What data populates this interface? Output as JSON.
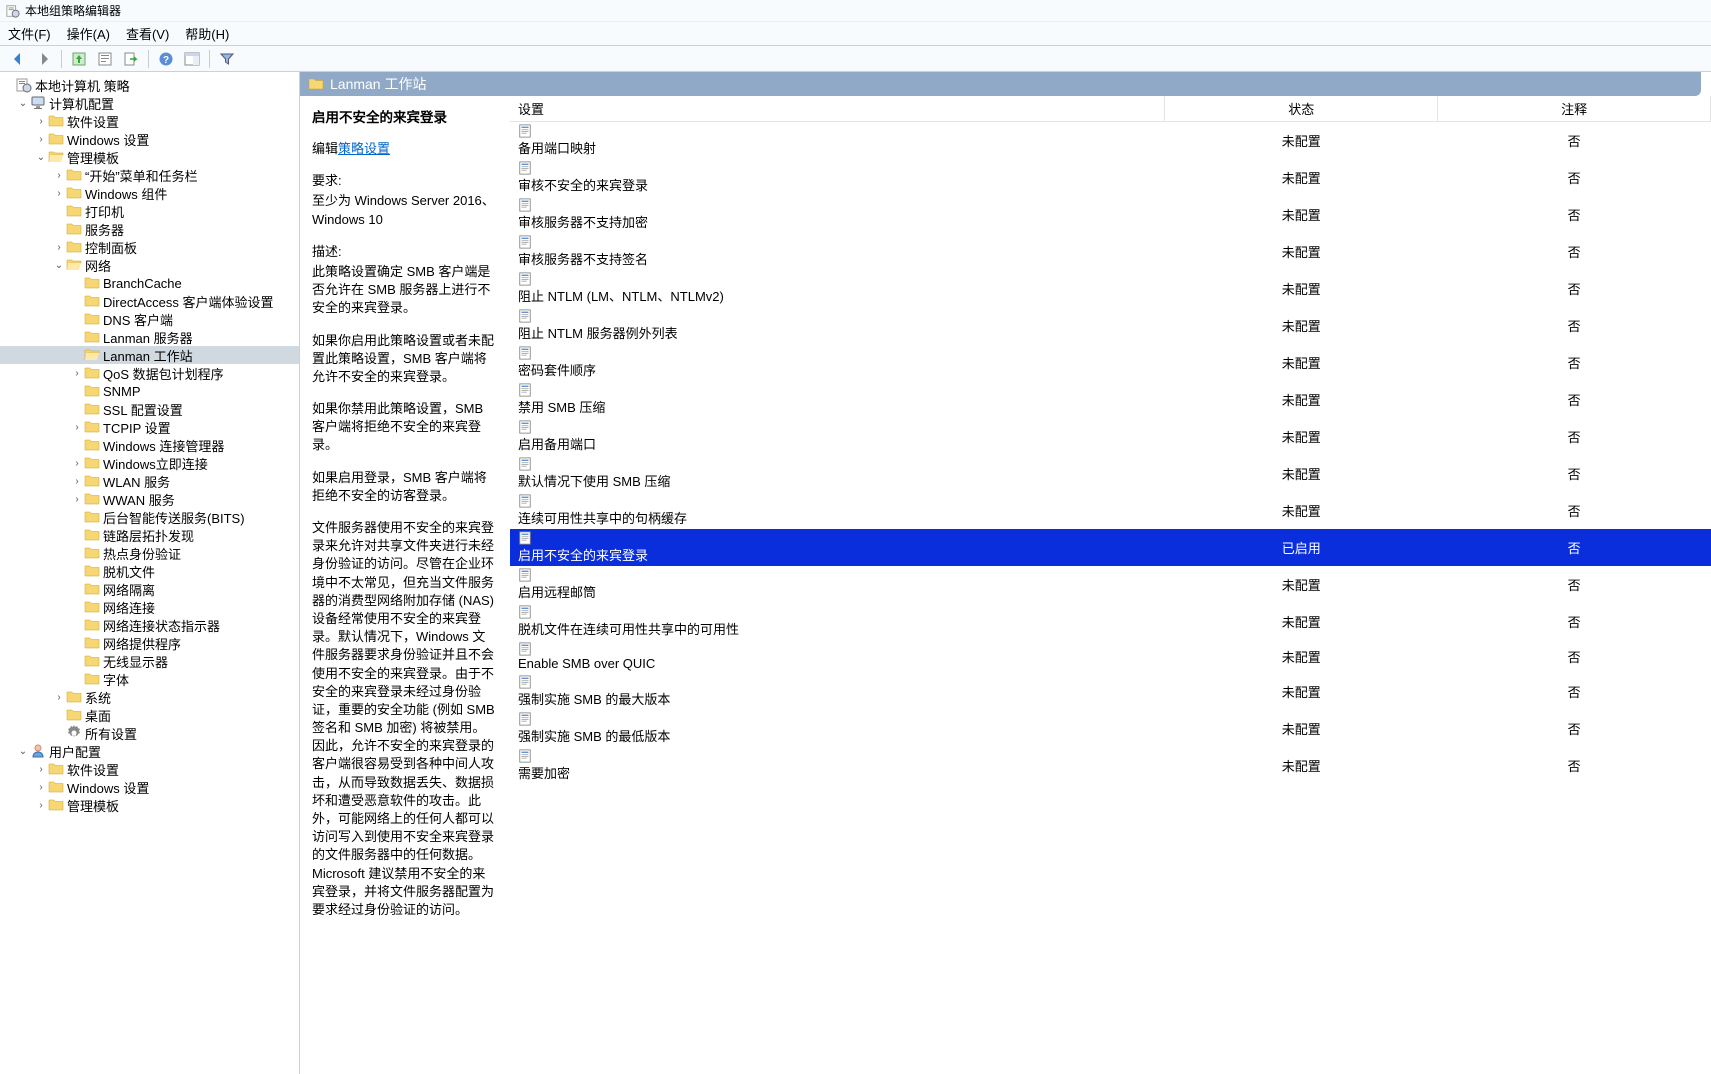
{
  "window": {
    "title": "本地组策略编辑器"
  },
  "menu": {
    "file": "文件(F)",
    "action": "操作(A)",
    "view": "查看(V)",
    "help": "帮助(H)"
  },
  "tree": {
    "root": "本地计算机 策略",
    "computer": "计算机配置",
    "sw_settings": "软件设置",
    "win_settings": "Windows 设置",
    "admin_templates": "管理模板",
    "start_menu": "“开始”菜单和任务栏",
    "win_components": "Windows 组件",
    "printers": "打印机",
    "server": "服务器",
    "control_panel": "控制面板",
    "network": "网络",
    "branchcache": "BranchCache",
    "directaccess": "DirectAccess 客户端体验设置",
    "dns_client": "DNS 客户端",
    "lanman_server": "Lanman 服务器",
    "lanman_workstation": "Lanman 工作站",
    "qos": "QoS 数据包计划程序",
    "snmp": "SNMP",
    "ssl": "SSL 配置设置",
    "tcpip": "TCPIP 设置",
    "win_conn_mgr": "Windows 连接管理器",
    "win_instant": "Windows立即连接",
    "wlan": "WLAN 服务",
    "wwan": "WWAN 服务",
    "bits": "后台智能传送服务(BITS)",
    "lltd": "链路层拓扑发现",
    "hotspot": "热点身份验证",
    "offline_files": "脱机文件",
    "net_isolation": "网络隔离",
    "net_conn": "网络连接",
    "ncsi": "网络连接状态指示器",
    "net_provider": "网络提供程序",
    "wireless_display": "无线显示器",
    "fonts": "字体",
    "system": "系统",
    "desktop": "桌面",
    "all_settings": "所有设置",
    "user": "用户配置",
    "u_sw": "软件设置",
    "u_win": "Windows 设置",
    "u_admin": "管理模板"
  },
  "breadcrumb": {
    "title": "Lanman 工作站"
  },
  "columns": {
    "setting": "设置",
    "state": "状态",
    "comment": "注释"
  },
  "desc": {
    "title": "启用不安全的来宾登录",
    "edit_prefix": "编辑",
    "edit_link": "策略设置",
    "req_label": "要求:",
    "req_text": "至少为 Windows Server 2016、Windows 10",
    "desc_label": "描述:",
    "p1": "此策略设置确定 SMB 客户端是否允许在 SMB 服务器上进行不安全的来宾登录。",
    "p2": "如果你启用此策略设置或者未配置此策略设置，SMB 客户端将允许不安全的来宾登录。",
    "p3": "如果你禁用此策略设置，SMB 客户端将拒绝不安全的来宾登录。",
    "p4": "如果启用登录，SMB 客户端将拒绝不安全的访客登录。",
    "p5": "文件服务器使用不安全的来宾登录来允许对共享文件夹进行未经身份验证的访问。尽管在企业环境中不太常见，但充当文件服务器的消费型网络附加存储 (NAS) 设备经常使用不安全的来宾登录。默认情况下，Windows 文件服务器要求身份验证并且不会使用不安全的来宾登录。由于不安全的来宾登录未经过身份验证，重要的安全功能 (例如 SMB 签名和 SMB 加密) 将被禁用。因此，允许不安全的来宾登录的客户端很容易受到各种中间人攻击，从而导致数据丢失、数据损坏和遭受恶意软件的攻击。此外，可能网络上的任何人都可以访问写入到使用不安全来宾登录的文件服务器中的任何数据。Microsoft 建议禁用不安全的来宾登录，并将文件服务器配置为要求经过身份验证的访问。"
  },
  "rows": [
    {
      "name": "备用端口映射",
      "state": "未配置",
      "comment": "否"
    },
    {
      "name": "审核不安全的来宾登录",
      "state": "未配置",
      "comment": "否"
    },
    {
      "name": "审核服务器不支持加密",
      "state": "未配置",
      "comment": "否"
    },
    {
      "name": "审核服务器不支持签名",
      "state": "未配置",
      "comment": "否"
    },
    {
      "name": "阻止 NTLM (LM、NTLM、NTLMv2)",
      "state": "未配置",
      "comment": "否"
    },
    {
      "name": "阻止 NTLM 服务器例外列表",
      "state": "未配置",
      "comment": "否"
    },
    {
      "name": "密码套件顺序",
      "state": "未配置",
      "comment": "否"
    },
    {
      "name": "禁用 SMB 压缩",
      "state": "未配置",
      "comment": "否"
    },
    {
      "name": "启用备用端口",
      "state": "未配置",
      "comment": "否"
    },
    {
      "name": "默认情况下使用 SMB 压缩",
      "state": "未配置",
      "comment": "否"
    },
    {
      "name": "连续可用性共享中的句柄缓存",
      "state": "未配置",
      "comment": "否"
    },
    {
      "name": "启用不安全的来宾登录",
      "state": "已启用",
      "comment": "否",
      "selected": true
    },
    {
      "name": "启用远程邮筒",
      "state": "未配置",
      "comment": "否"
    },
    {
      "name": "脱机文件在连续可用性共享中的可用性",
      "state": "未配置",
      "comment": "否"
    },
    {
      "name": "Enable SMB over QUIC",
      "state": "未配置",
      "comment": "否"
    },
    {
      "name": "强制实施 SMB 的最大版本",
      "state": "未配置",
      "comment": "否"
    },
    {
      "name": "强制实施 SMB 的最低版本",
      "state": "未配置",
      "comment": "否"
    },
    {
      "name": "需要加密",
      "state": "未配置",
      "comment": "否"
    }
  ]
}
